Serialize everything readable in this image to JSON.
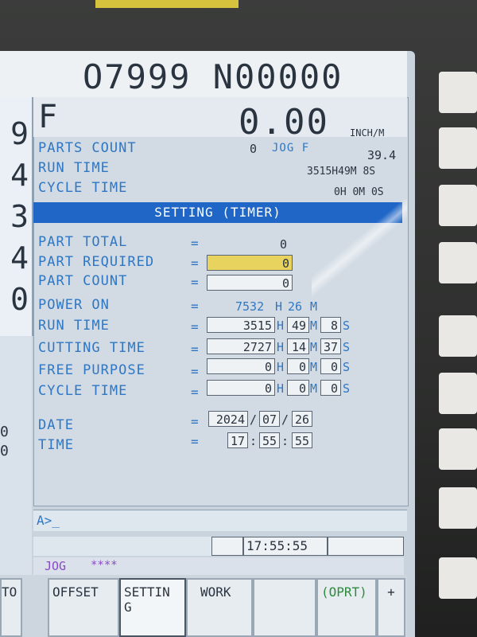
{
  "header": {
    "program_block": "O7999 N00000"
  },
  "left_digits": [
    "9",
    "4",
    "3",
    "4",
    "0"
  ],
  "left_lower_digits": [
    "0",
    "0"
  ],
  "feed": {
    "letter": "F",
    "value": "0.00",
    "unit": "INCH/M"
  },
  "top_info": [
    {
      "label": "PARTS COUNT",
      "value": "0"
    },
    {
      "label": "RUN TIME",
      "value": "3515H49M 8S"
    },
    {
      "label": "CYCLE TIME",
      "value": "0H 0M 0S"
    }
  ],
  "jog_feed": {
    "label": "JOG F",
    "value": "39.4"
  },
  "banner_title": "SETTING (TIMER)",
  "timer_rows": {
    "part_total": {
      "label": "PART TOTAL",
      "value": "0"
    },
    "part_required": {
      "label": "PART REQUIRED",
      "value": "0"
    },
    "part_count": {
      "label": "PART COUNT",
      "value": "0"
    },
    "power_on": {
      "label": "POWER ON",
      "h": "7532",
      "m": "26"
    },
    "run_time": {
      "label": "RUN TIME",
      "h": "3515",
      "m": "49",
      "s": "8"
    },
    "cutting_time": {
      "label": "CUTTING TIME",
      "h": "2727",
      "m": "14",
      "s": "37"
    },
    "free_purpose": {
      "label": "FREE PURPOSE",
      "h": "0",
      "m": "0",
      "s": "0"
    },
    "cycle_time": {
      "label": "CYCLE TIME",
      "h": "0",
      "m": "0",
      "s": "0"
    }
  },
  "date": {
    "label": "DATE",
    "y": "2024",
    "m": "07",
    "d": "26"
  },
  "time": {
    "label": "TIME",
    "h": "17",
    "m": "55",
    "s": "55"
  },
  "units": {
    "h": "H",
    "m": "M",
    "s": "S",
    "eq": "=",
    "slash": "/",
    "colon": ":"
  },
  "input_prompt": "A>_",
  "status_clock": "17:55:55",
  "mode": {
    "label": "JOG",
    "stars": "****"
  },
  "softkeys": {
    "left_cut": "TO",
    "offset": "OFFSET",
    "setting": "SETTIN\nG",
    "work": "WORK",
    "oprt": "(OPRT)",
    "plus": "+"
  },
  "colors": {
    "label_blue": "#2f77c4",
    "banner_blue": "#1f66c6",
    "highlight": "#e8d35e",
    "mode_purple": "#8a49c8"
  }
}
